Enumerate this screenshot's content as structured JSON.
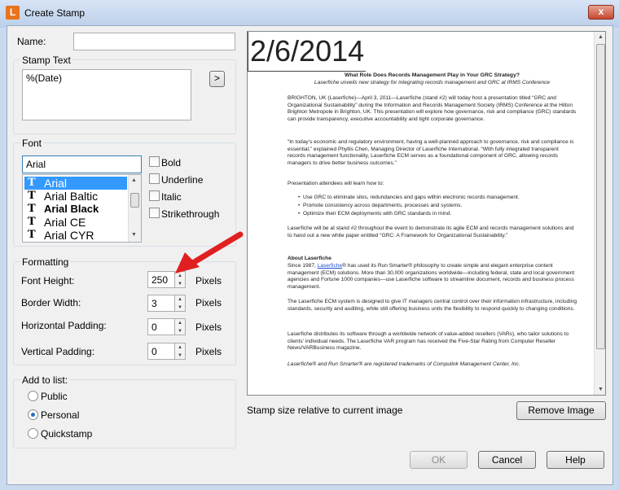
{
  "window": {
    "title": "Create Stamp",
    "app_icon_letter": "L",
    "close_glyph": "x"
  },
  "name_field": {
    "label": "Name:",
    "value": ""
  },
  "stamp_text": {
    "group_label": "Stamp Text",
    "value": "%(Date)",
    "insert_button": ">"
  },
  "font": {
    "group_label": "Font",
    "current": "Arial",
    "list": [
      {
        "name": "Arial",
        "selected": true
      },
      {
        "name": "Arial Baltic",
        "selected": false
      },
      {
        "name": "Arial Black",
        "selected": false
      },
      {
        "name": "Arial CE",
        "selected": false
      },
      {
        "name": "Arial CYR",
        "selected": false
      }
    ],
    "styles": [
      "Bold",
      "Underline",
      "Italic",
      "Strikethrough"
    ]
  },
  "formatting": {
    "group_label": "Formatting",
    "rows": [
      {
        "label": "Font Height:",
        "value": "250",
        "unit": "Pixels"
      },
      {
        "label": "Border Width:",
        "value": "3",
        "unit": "Pixels"
      },
      {
        "label": "Horizontal Padding:",
        "value": "0",
        "unit": "Pixels"
      },
      {
        "label": "Vertical Padding:",
        "value": "0",
        "unit": "Pixels"
      }
    ]
  },
  "add_to_list": {
    "group_label": "Add to list:",
    "options": [
      {
        "label": "Public",
        "checked": false
      },
      {
        "label": "Personal",
        "checked": true
      },
      {
        "label": "Quickstamp",
        "checked": false
      }
    ]
  },
  "preview": {
    "stamp_text": "2/6/2014",
    "doc_title": "What Role Does Records Management Play in Your GRC Strategy?",
    "doc_subtitle": "Laserfiche unveils new strategy for integrating records management and GRC at IRMS Conference",
    "paragraphs": [
      "BRIGHTON, UK (Laserfiche)—April 3, 2011—Laserfiche (stand #2) will today host a presentation titled “GRC and Organizational Sustainability” during the Information and Records Management Society (IRMS) Conference at the Hilton Brighton Metropole in Brighton, UK. This presentation will explore how governance, risk and compliance (GRC) standards can provide transparency, executive accountability and tight corporate governance.",
      "“In today’s economic and regulatory environment, having a well-planned approach to governance, risk and compliance is essential,” explained Phyllis Chen, Managing Director of Laserfiche International. “With fully integrated transparent records management functionality, Laserfiche ECM serves as a foundational component of GRC, allowing records managers to drive better business outcomes.”",
      "Presentation attendees will learn how to:"
    ],
    "bullets": [
      "Use GRC to eliminate silos, redundancies and gaps within electronic records management.",
      "Promote consistency across departments, processes and systems.",
      "Optimize their ECM deployments with GRC standards in mind."
    ],
    "paragraphs2": [
      "Laserfiche will be at stand #2 throughout the event to demonstrate its agile ECM and records management solutions and to hand out a new white paper entitled “GRC: A Framework for Organizational Sustainability.”"
    ],
    "about_heading": "About Laserfiche",
    "about_pre": "Since 1987,",
    "about_link": "Laserfiche",
    "about_post": "® has used its Run Smarter® philosophy to create simple and elegant enterprise content management (ECM) solutions. More than 30,000 organizations worldwide—including federal, state and local government agencies and Fortune 1000 companies—use Laserfiche software to streamline document, records and business process management.",
    "paragraphs3": [
      "The Laserfiche ECM system is designed to give IT managers central control over their information infrastructure, including standards, security and auditing, while still offering business units the flexibility to respond quickly to changing conditions.",
      "Laserfiche distributes its software through a worldwide network of value-added resellers (VARs), who tailor solutions to clients’ individual needs. The Laserfiche VAR program has received the Five-Star Rating from Computer Reseller News/VARBusiness magazine."
    ],
    "trademark": "Laserfiche® and Run Smarter® are registered trademarks of Compulink Management Center, Inc."
  },
  "stamp_size_label": "Stamp size relative to current image",
  "buttons": {
    "remove_image": "Remove Image",
    "ok": "OK",
    "cancel": "Cancel",
    "help": "Help"
  },
  "colors": {
    "selection": "#3399ff",
    "arrow": "#e02020",
    "link": "#1a4fd6"
  }
}
